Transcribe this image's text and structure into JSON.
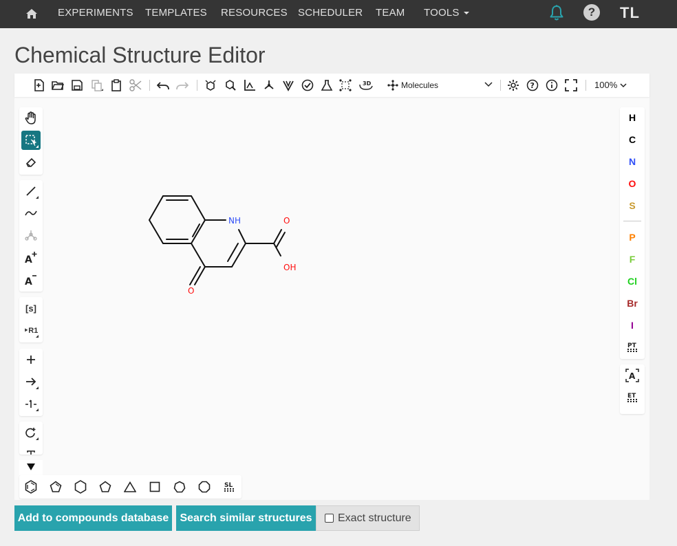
{
  "nav": {
    "items": [
      "EXPERIMENTS",
      "TEMPLATES",
      "RESOURCES",
      "SCHEDULER",
      "TEAM",
      "TOOLS"
    ],
    "help": "?",
    "user_initials": "TL",
    "accent": "#29a3ad"
  },
  "page": {
    "title": "Chemical Structure Editor"
  },
  "editor": {
    "mode": "Molecules",
    "zoom": "100%",
    "top_icons": [
      "new-file-icon",
      "open-icon",
      "save-icon",
      "copy-icon",
      "paste-icon",
      "cut-icon",
      "undo-icon",
      "redo-icon",
      "layout-icon",
      "clean-icon",
      "arom-icon",
      "calc-icon",
      "check-icon",
      "analyse-icon",
      "explicit-h-icon",
      "3d-icon",
      "settings-icon",
      "help-icon",
      "about-icon",
      "fullscreen-icon"
    ],
    "left_labels": {
      "sgroup": "[s]",
      "rgroup": "R1"
    },
    "atoms": [
      {
        "symbol": "H",
        "color": "#000000"
      },
      {
        "symbol": "C",
        "color": "#000000"
      },
      {
        "symbol": "N",
        "color": "#304ff7"
      },
      {
        "symbol": "O",
        "color": "#ff0d0d"
      },
      {
        "symbol": "S",
        "color": "#c99a2e"
      },
      {
        "symbol": "P",
        "color": "#ff8000"
      },
      {
        "symbol": "F",
        "color": "#78cc3a"
      },
      {
        "symbol": "Cl",
        "color": "#1fd01f"
      },
      {
        "symbol": "Br",
        "color": "#a62929"
      },
      {
        "symbol": "I",
        "color": "#940094"
      }
    ],
    "right_extra": {
      "periodic_table": "PT",
      "any_atom": "A",
      "extended_table": "ET"
    },
    "bottom_extra": {
      "structure_library": "SL"
    },
    "molecule_labels": {
      "nh": "NH",
      "o_top": "O",
      "oh": "OH",
      "o_bottom": "O"
    }
  },
  "actions": {
    "add_compounds": "Add to compounds database",
    "search_similar": "Search similar structures",
    "exact_structure": "Exact structure"
  }
}
